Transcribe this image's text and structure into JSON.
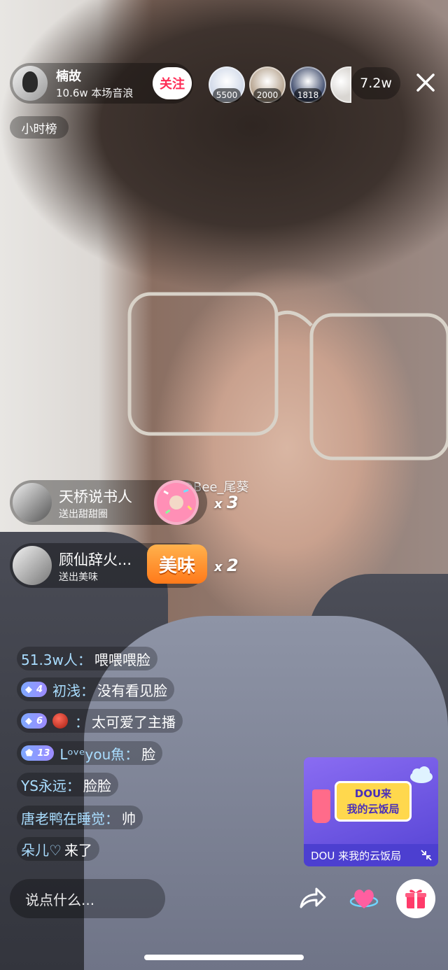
{
  "host": {
    "name": "楠故",
    "sound_wave": "10.6w 本场音浪",
    "follow_label": "关注",
    "rank_label": "小时榜"
  },
  "top_viewers": [
    {
      "badge": "5500",
      "color": "#cfd8e8"
    },
    {
      "badge": "2000",
      "color": "#b5a28d"
    },
    {
      "badge": "1818",
      "color": "#3d4a6b"
    },
    {
      "badge": "",
      "color": "#d9d6d2"
    }
  ],
  "online_count": "7.2w",
  "watermark": "@Bee_尾葵",
  "gifts": [
    {
      "user": "天桥说书人",
      "action": "送出甜甜圈",
      "gift_icon": "donut-gift-icon",
      "count": "3"
    },
    {
      "user": "顾仙辞火...",
      "action": "送出美味",
      "gift_icon": "meiwei-gift-icon",
      "gift_text": "美味",
      "count": "2"
    }
  ],
  "chat": [
    {
      "user": "51.3w人：",
      "text": "喂喂喂脸"
    },
    {
      "level": "4",
      "user": "初浅：",
      "text": "没有看见脸"
    },
    {
      "level": "6",
      "emoji": "red-devil-emoji",
      "user": "：",
      "text": "太可爱了主播"
    },
    {
      "level": "13",
      "user": "Lᵒᵛᵉyou魚：",
      "text": "脸"
    },
    {
      "user": "YS永远：",
      "text": "脸脸"
    },
    {
      "user": "唐老鸭在睡觉：",
      "text": "帅"
    },
    {
      "user": "朵儿♡",
      "text": " 来了"
    }
  ],
  "promo": {
    "sign_text": "DOU来\n我的云饭局",
    "caption": "DOU 来我的云饭局"
  },
  "bottom": {
    "comment_placeholder": "说点什么..."
  },
  "colors": {
    "follow": "#fe2c55",
    "chat_user": "#a9ddff",
    "promo_bg": "#6d59e6"
  }
}
